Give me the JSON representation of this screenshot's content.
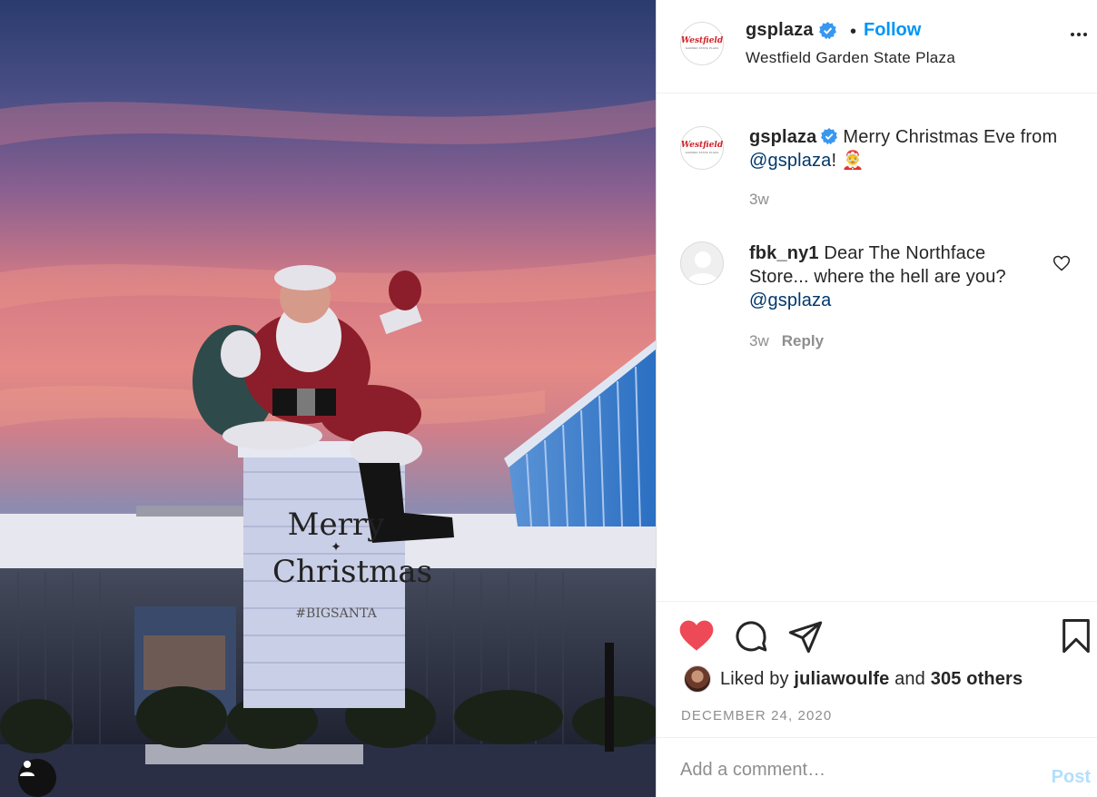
{
  "post": {
    "username": "gsplaza",
    "follow_label": "Follow",
    "separator": "•",
    "location": "Westfield Garden State Plaza",
    "avatar": {
      "brand": "Westfield",
      "sub": "GARDEN STATE PLAZA"
    },
    "photo": {
      "sign_line1": "Merry",
      "sign_line2": "Christmas",
      "sign_hashtag": "#BIGSANTA"
    }
  },
  "comments": [
    {
      "username": "gsplaza",
      "text_before": "Merry Christmas Eve from ",
      "mention": "@gsplaza",
      "text_after": "! 🤶",
      "time": "3w"
    },
    {
      "username": "fbk_ny1",
      "text_before": "Dear The Northface Store... where the hell are you? ",
      "mention": "@gsplaza",
      "text_after": "",
      "time": "3w",
      "reply_label": "Reply"
    }
  ],
  "likes": {
    "prefix": "Liked by ",
    "user": "juliawoulfe",
    "middle": " and ",
    "others": "305 others"
  },
  "date": "DECEMBER 24, 2020",
  "comment_box": {
    "placeholder": "Add a comment…",
    "post_label": "Post"
  },
  "icons": {
    "like": "heart-filled-icon",
    "comment": "comment-bubble-icon",
    "share": "paper-plane-icon",
    "save": "bookmark-icon",
    "more": "ellipsis-icon",
    "verified": "verified-badge-icon",
    "user": "user-silhouette-icon"
  },
  "colors": {
    "like_red": "#ed4956",
    "link_blue": "#0095f6",
    "mention_blue": "#00376b",
    "verified": "#3897f0"
  }
}
